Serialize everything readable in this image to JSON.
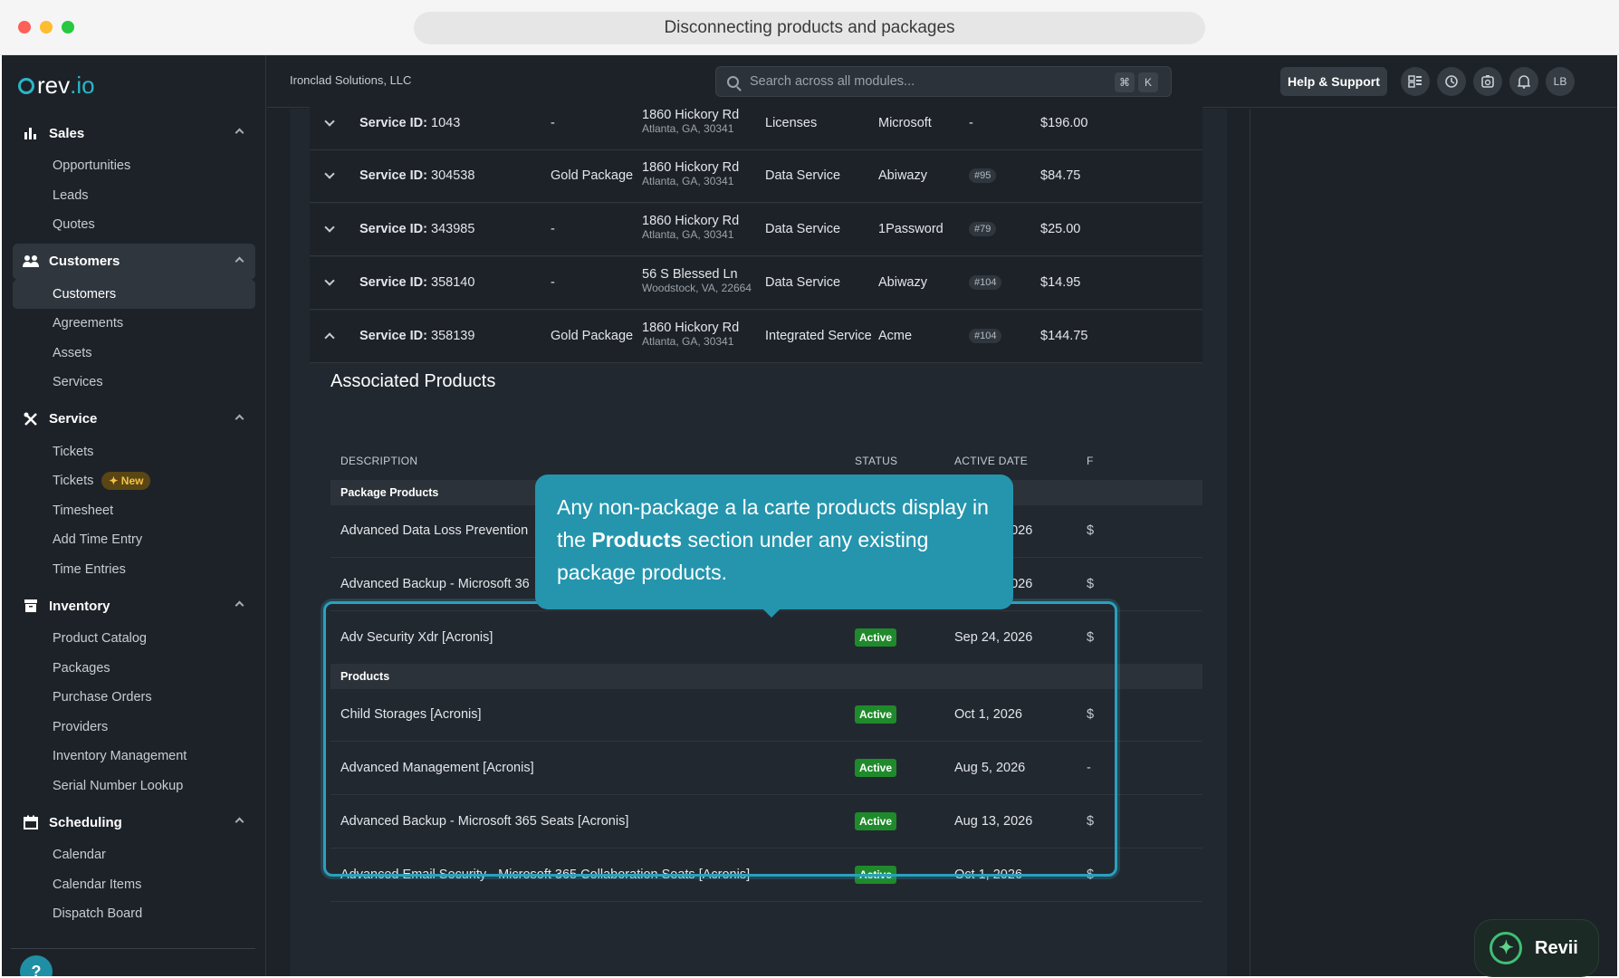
{
  "browser": {
    "title": "Disconnecting products and packages"
  },
  "logo": {
    "text": "rev",
    "suffix": ".io"
  },
  "topbar": {
    "org": "Ironclad Solutions, LLC",
    "search_placeholder": "Search across all modules...",
    "kbd_cmd": "⌘",
    "kbd_k": "K",
    "help_label": "Help & Support",
    "avatar": "LB"
  },
  "sidebar": {
    "sales": {
      "label": "Sales",
      "items": [
        "Opportunities",
        "Leads",
        "Quotes"
      ]
    },
    "customers": {
      "label": "Customers",
      "items": [
        "Customers",
        "Agreements",
        "Assets",
        "Services"
      ]
    },
    "service": {
      "label": "Service",
      "items": [
        "Tickets",
        "Tickets",
        "Timesheet",
        "Add Time Entry",
        "Time Entries"
      ],
      "new_badge": "✦ New"
    },
    "inventory": {
      "label": "Inventory",
      "items": [
        "Product Catalog",
        "Packages",
        "Purchase Orders",
        "Providers",
        "Inventory Management",
        "Serial Number Lookup"
      ]
    },
    "scheduling": {
      "label": "Scheduling",
      "items": [
        "Calendar",
        "Calendar Items",
        "Dispatch Board"
      ]
    },
    "help_glyph": "?"
  },
  "services": {
    "id_label": "Service ID:",
    "rows": [
      {
        "id": "1043",
        "package": "-",
        "addr1": "1860 Hickory Rd",
        "addr2": "Atlanta, GA, 30341",
        "type": "Licenses",
        "provider": "Microsoft",
        "tag": "-",
        "amount": "$196.00"
      },
      {
        "id": "304538",
        "package": "Gold Package",
        "addr1": "1860 Hickory Rd",
        "addr2": "Atlanta, GA, 30341",
        "type": "Data Service",
        "provider": "Abiwazy",
        "tag": "#95",
        "amount": "$84.75"
      },
      {
        "id": "343985",
        "package": "-",
        "addr1": "1860 Hickory Rd",
        "addr2": "Atlanta, GA, 30341",
        "type": "Data Service",
        "provider": "1Password",
        "tag": "#79",
        "amount": "$25.00"
      },
      {
        "id": "358140",
        "package": "-",
        "addr1": "56 S Blessed Ln",
        "addr2": "Woodstock, VA, 22664",
        "type": "Data Service",
        "provider": "Abiwazy",
        "tag": "#104",
        "amount": "$14.95"
      },
      {
        "id": "358139",
        "package": "Gold Package",
        "addr1": "1860 Hickory Rd",
        "addr2": "Atlanta, GA, 30341",
        "type": "Integrated Service",
        "provider": "Acme",
        "tag": "#104",
        "amount": "$144.75"
      }
    ]
  },
  "associated": {
    "title": "Associated Products",
    "headers": {
      "description": "DESCRIPTION",
      "status": "STATUS",
      "active_date": "ACTIVE DATE",
      "cut": "F"
    },
    "package_group": "Package Products",
    "package_rows": [
      {
        "desc": "Advanced Data Loss Prevention",
        "status": "",
        "date": "Sep 24, 2026",
        "cut": "$"
      },
      {
        "desc": "Advanced Backup - Microsoft 36",
        "status": "",
        "date": "Sep 24, 2026",
        "cut": "$"
      },
      {
        "desc": "Adv Security Xdr [Acronis]",
        "status": "Active",
        "date": "Sep 24, 2026",
        "cut": "$"
      }
    ],
    "products_group": "Products",
    "product_rows": [
      {
        "desc": "Child Storages [Acronis]",
        "status": "Active",
        "date": "Oct 1, 2026",
        "cut": "$"
      },
      {
        "desc": "Advanced Management [Acronis]",
        "status": "Active",
        "date": "Aug 5, 2026",
        "cut": "-"
      },
      {
        "desc": "Advanced Backup - Microsoft 365 Seats [Acronis]",
        "status": "Active",
        "date": "Aug 13, 2026",
        "cut": "$"
      },
      {
        "desc": "Advanced Email Security - Microsoft 365 Collaboration Seats [Acronis]",
        "status": "Active",
        "date": "Oct 1, 2026",
        "cut": "$"
      }
    ]
  },
  "tooltip": {
    "pre": "Any non-package a la carte products display in the ",
    "bold": "Products",
    "post": " section under any existing package products."
  },
  "revii": {
    "label": "Revii"
  },
  "colors": {
    "accent": "#2495ad",
    "active": "#1f8a2b",
    "bg": "#1d2228"
  }
}
